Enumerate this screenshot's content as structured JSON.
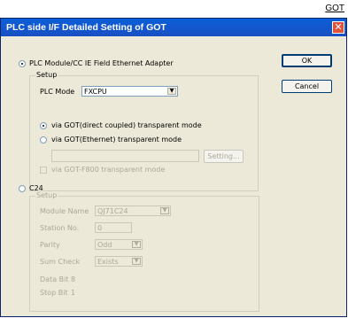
{
  "badge": "GOT",
  "dialog": {
    "title": "PLC side I/F Detailed Setting of GOT",
    "close_glyph": "✕",
    "ok_label": "OK",
    "cancel_label": "Cancel"
  },
  "ethernet": {
    "radio_label": "PLC Module/CC IE Field Ethernet Adapter",
    "setup_title": "Setup",
    "plc_mode_label": "PLC Mode",
    "plc_mode_value": "FXCPU",
    "via_direct_label": "via GOT(direct coupled) transparent mode",
    "via_ethernet_label": "via GOT(Ethernet) transparent mode",
    "setting_button": "Setting...",
    "f800_label": "via GOT-F800 transparent mode"
  },
  "c24": {
    "radio_label": "C24",
    "setup_title": "Setup",
    "module_name_label": "Module Name",
    "module_name_value": "QJ71C24",
    "station_no_label": "Station No.",
    "station_no_value": "0",
    "parity_label": "Parity",
    "parity_value": "Odd",
    "sum_check_label": "Sum Check",
    "sum_check_value": "Exists",
    "data_bit_label": "Data Bit",
    "data_bit_value": "8",
    "stop_bit_label": "Stop Bit",
    "stop_bit_value": "1"
  }
}
